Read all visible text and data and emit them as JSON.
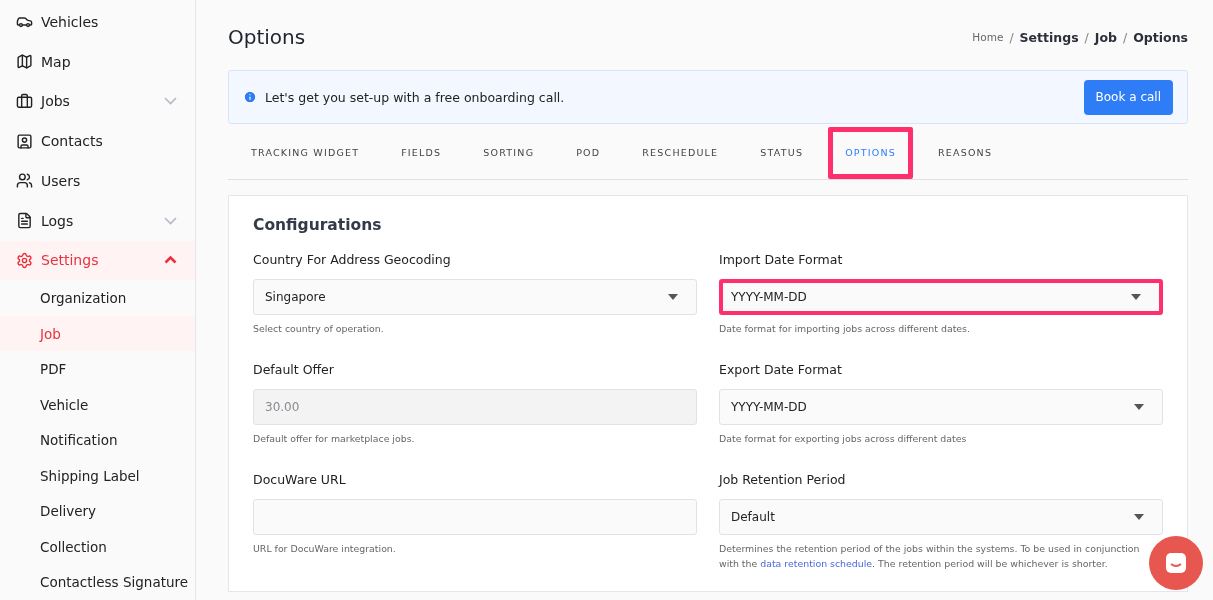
{
  "sidebar": {
    "items": [
      {
        "label": "Vehicles",
        "selected": false
      },
      {
        "label": "Map",
        "selected": false
      },
      {
        "label": "Jobs",
        "selected": false,
        "expanded": false
      },
      {
        "label": "Contacts",
        "selected": false
      },
      {
        "label": "Users",
        "selected": false
      },
      {
        "label": "Logs",
        "selected": false,
        "expanded": false
      },
      {
        "label": "Settings",
        "selected": true,
        "expanded": true,
        "children": [
          {
            "label": "Organization",
            "selected": false
          },
          {
            "label": "Job",
            "selected": true
          },
          {
            "label": "PDF",
            "selected": false
          },
          {
            "label": "Vehicle",
            "selected": false
          },
          {
            "label": "Notification",
            "selected": false
          },
          {
            "label": "Shipping Label",
            "selected": false
          },
          {
            "label": "Delivery",
            "selected": false
          },
          {
            "label": "Collection",
            "selected": false
          },
          {
            "label": "Contactless Signature",
            "selected": false
          }
        ]
      }
    ]
  },
  "page": {
    "title": "Options",
    "breadcrumb": [
      "Home",
      "Settings",
      "Job",
      "Options"
    ],
    "breadcrumb_separators": [
      "/",
      "/",
      "/"
    ]
  },
  "banner": {
    "text": "Let's get you set-up with a free onboarding call.",
    "button": "Book a call"
  },
  "tabs": [
    {
      "label": "TRACKING WIDGET",
      "selected": false,
      "highlighted": false
    },
    {
      "label": "FIELDS",
      "selected": false,
      "highlighted": false
    },
    {
      "label": "SORTING",
      "selected": false,
      "highlighted": false
    },
    {
      "label": "POD",
      "selected": false,
      "highlighted": false
    },
    {
      "label": "RESCHEDULE",
      "selected": false,
      "highlighted": false
    },
    {
      "label": "STATUS",
      "selected": false,
      "highlighted": false
    },
    {
      "label": "OPTIONS",
      "selected": true,
      "highlighted": true
    },
    {
      "label": "REASONS",
      "selected": false,
      "highlighted": false
    }
  ],
  "card": {
    "title": "Configurations",
    "fields": [
      {
        "label": "Country For Address Geocoding",
        "kind": "select",
        "value": "Singapore",
        "help": "Select country of operation.",
        "highlighted": false
      },
      {
        "label": "Import Date Format",
        "kind": "select",
        "value": "YYYY-MM-DD",
        "help": "Date format for importing jobs across different dates.",
        "highlighted": true
      },
      {
        "label": "Default Offer",
        "kind": "input",
        "value": "30.00",
        "disabled": true,
        "help": "Default offer for marketplace jobs.",
        "highlighted": false
      },
      {
        "label": "Export Date Format",
        "kind": "select",
        "value": "YYYY-MM-DD",
        "help": "Date format for exporting jobs across different dates",
        "highlighted": false
      },
      {
        "label": "DocuWare URL",
        "kind": "input",
        "help": "URL for DocuWare integration.",
        "highlighted": false
      },
      {
        "label": "Job Retention Period",
        "kind": "select",
        "value": "Default",
        "help": "Determines the retention period of the jobs within the systems. To be used in conjunction with the ",
        "help_link": "data retention schedule",
        "help_after": ". The retention period will be whichever is shorter.",
        "highlighted": false
      }
    ]
  }
}
